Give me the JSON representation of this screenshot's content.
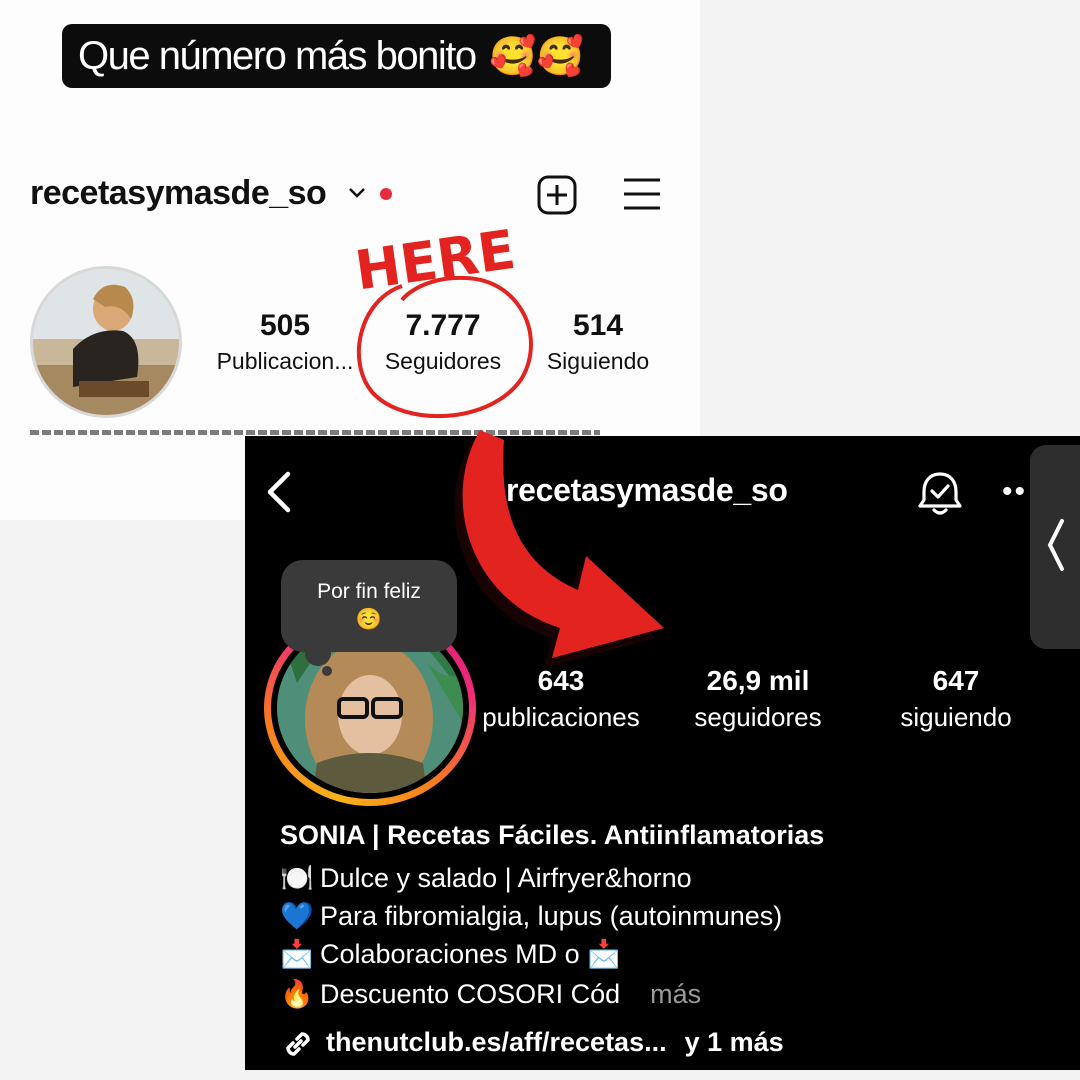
{
  "caption": {
    "text": "Que número más bonito",
    "emojis": "🥰🥰"
  },
  "top_profile": {
    "username": "recetasymasde_so",
    "stats": [
      {
        "value": "505",
        "label": "Publicacion..."
      },
      {
        "value": "7.777",
        "label": "Seguidores"
      },
      {
        "value": "514",
        "label": "Siguiendo"
      }
    ]
  },
  "annotation": {
    "text": "HERE",
    "color": "#e3231f"
  },
  "bottom_profile": {
    "username": "recetasymasde_so",
    "note": {
      "text": "Por fin feliz",
      "emoji": "☺️"
    },
    "stats": [
      {
        "value": "643",
        "label": "publicaciones"
      },
      {
        "value": "26,9 mil",
        "label": "seguidores"
      },
      {
        "value": "647",
        "label": "siguiendo"
      }
    ],
    "name": "SONIA | Recetas Fáciles. Antiinflamatorias",
    "bio": [
      {
        "icon": "🍽️",
        "text": "Dulce y salado | Airfryer&horno"
      },
      {
        "icon": "💙",
        "text": "Para fibromialgia, lupus (autoinmunes)"
      },
      {
        "icon": "📩",
        "text": "Colaboraciones MD o",
        "trail": "📩"
      },
      {
        "icon": "🔥",
        "text": "Descuento COSORI Cód",
        "more": "más"
      }
    ],
    "link": {
      "text": "thenutclub.es/aff/recetas...",
      "extra": "y 1 más"
    }
  },
  "colors": {
    "notification_dot": "#ea2a3f",
    "arrow": "#e3231f",
    "dark_bg": "#000000"
  }
}
